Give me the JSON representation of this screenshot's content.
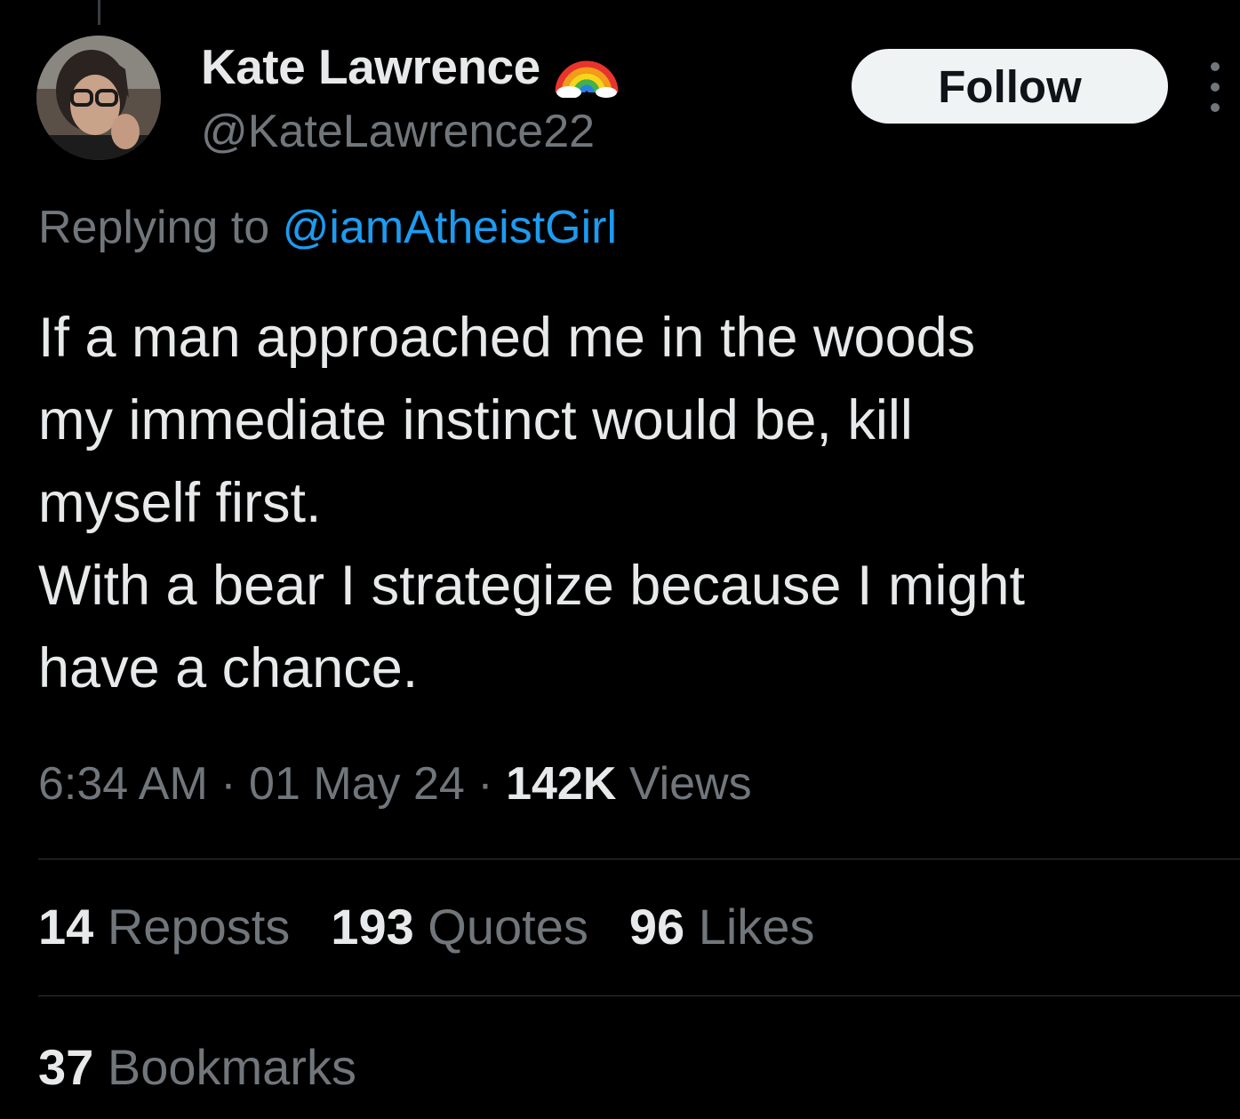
{
  "author": {
    "display_name": "Kate Lawrence",
    "badge_icon": "rainbow-icon",
    "handle": "@KateLawrence22",
    "avatar_icon": "profile-photo"
  },
  "header": {
    "follow_label": "Follow",
    "more_icon": "more-options-icon"
  },
  "reply": {
    "prefix": "Replying to",
    "mention": "@iamAtheistGirl"
  },
  "tweet": {
    "lines": [
      "If a man approached me in the woods",
      "my immediate instinct would be, kill",
      "myself first.",
      "With a bear I strategize because I might",
      "have a chance."
    ]
  },
  "meta": {
    "time": "6:34 AM",
    "separator": "·",
    "date": "01 May 24",
    "views_count": "142K",
    "views_label": "Views"
  },
  "stats": {
    "reposts_count": "14",
    "reposts_label": "Reposts",
    "quotes_count": "193",
    "quotes_label": "Quotes",
    "likes_count": "96",
    "likes_label": "Likes",
    "bookmarks_count": "37",
    "bookmarks_label": "Bookmarks"
  },
  "colors": {
    "background": "#000000",
    "primary_text": "#e7e9ea",
    "secondary_text": "#71767b",
    "link": "#1d9bf0",
    "follow_bg": "#eff3f4",
    "divider": "#2f3336"
  }
}
